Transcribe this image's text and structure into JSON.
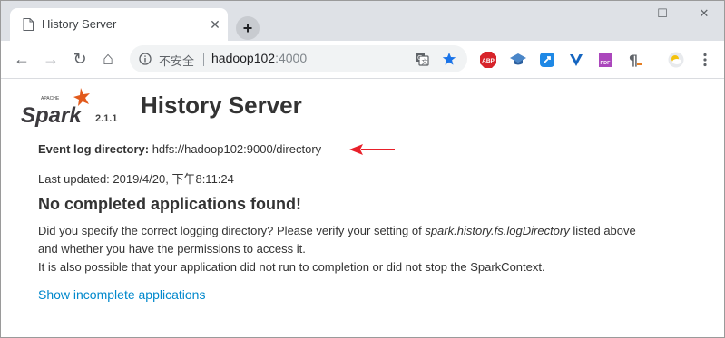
{
  "browser": {
    "tab": {
      "title": "History Server",
      "close_glyph": "✕"
    },
    "new_tab_glyph": "+",
    "window_controls": {
      "minimize_glyph": "—",
      "maximize_glyph": "☐",
      "close_glyph": "✕"
    },
    "nav": {
      "back_glyph": "←",
      "forward_glyph": "→",
      "reload_glyph": "↻",
      "home_glyph": "⌂"
    },
    "omnibox": {
      "security_label": "不安全",
      "host": "hadoop102",
      "port": ":4000"
    },
    "extensions": [
      "abp-extension-icon",
      "graduation-cap-extension-icon",
      "blue-square-extension-icon",
      "v-extension-icon",
      "pdf-extension-icon",
      "pilcrow-extension-icon",
      "weather-extension-icon",
      "more-menu-icon"
    ],
    "extension_labels": {
      "abp": "ABP",
      "pdf": "PDF",
      "pilcrow": "¶",
      "menu": "⋮"
    }
  },
  "page": {
    "logo_text": "Spark",
    "logo_apache": "APACHE",
    "version": "2.1.1",
    "title": "History Server",
    "event_log_label": "Event log directory:",
    "event_log_value": " hdfs://hadoop102:9000/directory",
    "last_updated_label": "Last updated: ",
    "last_updated_value": "2019/4/20, 下午8:11:24",
    "no_apps_heading": "No completed applications found!",
    "paragraph_line1_before": "Did you specify the correct logging directory? Please verify your setting of ",
    "paragraph_line1_italic": "spark.history.fs.logDirectory",
    "paragraph_line1_after": " listed above",
    "paragraph_line2": "and whether you have the permissions to access it.",
    "paragraph_line3": "It is also possible that your application did not run to completion or did not stop the SparkContext.",
    "show_incomplete_link": "Show incomplete applications"
  },
  "colors": {
    "link": "#0088cc",
    "annotation_arrow": "#e8202a",
    "spark_orange": "#e25a1c",
    "star_blue": "#1a73e8"
  }
}
